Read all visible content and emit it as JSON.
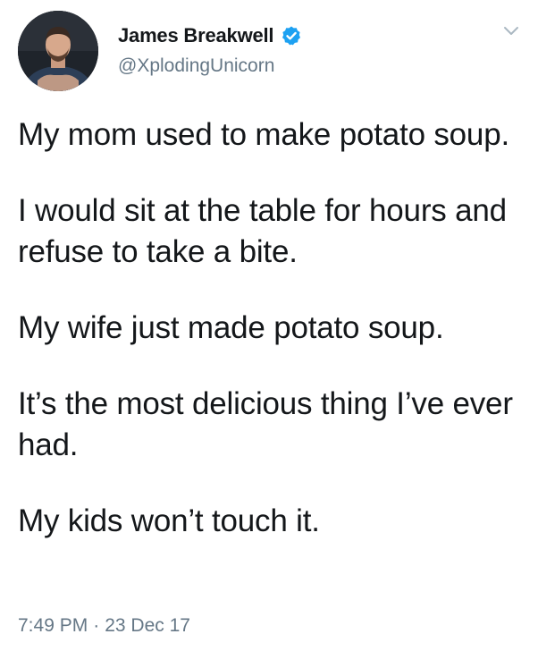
{
  "user": {
    "display_name": "James Breakwell",
    "handle": "@XplodingUnicorn",
    "verified": true,
    "avatar_icon": "user-avatar-photo",
    "verified_icon": "verified-badge-icon"
  },
  "menu": {
    "icon": "chevron-down-icon"
  },
  "tweet": {
    "paragraphs": [
      "My mom used to make potato soup.",
      "I would sit at the table for hours and refuse to take a bite.",
      "My wife just made potato soup.",
      "It’s the most delicious thing I’ve ever had.",
      "My kids won’t touch it."
    ],
    "time": "7:49 PM",
    "separator": "·",
    "date": "23 Dec 17"
  },
  "colors": {
    "text": "#14171a",
    "secondary": "#657786",
    "verified": "#1da1f2"
  }
}
